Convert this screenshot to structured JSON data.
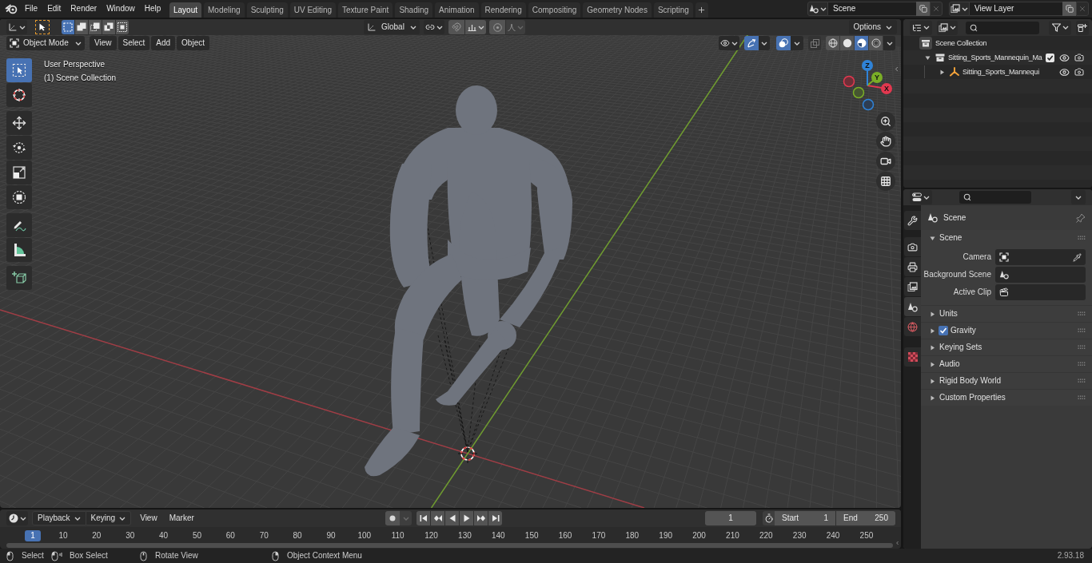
{
  "top_bar": {
    "menus": [
      "File",
      "Edit",
      "Render",
      "Window",
      "Help"
    ],
    "workspaces": [
      {
        "label": "Layout",
        "selected": true
      },
      {
        "label": "Modeling",
        "selected": false
      },
      {
        "label": "Sculpting",
        "selected": false
      },
      {
        "label": "UV Editing",
        "selected": false
      },
      {
        "label": "Texture Paint",
        "selected": false
      },
      {
        "label": "Shading",
        "selected": false
      },
      {
        "label": "Animation",
        "selected": false
      },
      {
        "label": "Rendering",
        "selected": false
      },
      {
        "label": "Compositing",
        "selected": false
      },
      {
        "label": "Geometry Nodes",
        "selected": false
      },
      {
        "label": "Scripting",
        "selected": false
      }
    ],
    "scene": "Scene",
    "view_layer": "View Layer"
  },
  "viewport": {
    "tool_settings": {
      "select_modes": [
        {
          "kind": "set",
          "selected": true
        },
        {
          "kind": "extend",
          "selected": false
        },
        {
          "kind": "subtract",
          "selected": false
        },
        {
          "kind": "difference",
          "selected": false
        },
        {
          "kind": "intersect",
          "selected": false
        }
      ],
      "orientation": "Global",
      "options": "Options"
    },
    "header": {
      "mode": "Object Mode",
      "menus": [
        "View",
        "Select",
        "Add",
        "Object"
      ],
      "gizmos_on": true,
      "overlays_on": true,
      "xray_on": false,
      "shading": [
        {
          "kind": "wireframe",
          "selected": false
        },
        {
          "kind": "solid",
          "selected": false
        },
        {
          "kind": "material",
          "selected": true
        },
        {
          "kind": "rendered",
          "selected": false
        }
      ]
    },
    "info": [
      "User Perspective",
      "(1) Scene Collection"
    ],
    "tool_groups": [
      [
        {
          "kind": "select_box",
          "selected": true
        },
        {
          "kind": "cursor",
          "selected": false
        }
      ],
      [
        {
          "kind": "move",
          "selected": false
        },
        {
          "kind": "rotate",
          "selected": false
        },
        {
          "kind": "scale",
          "selected": false
        },
        {
          "kind": "transform",
          "selected": false
        }
      ],
      [
        {
          "kind": "annotate",
          "selected": false
        },
        {
          "kind": "measure",
          "selected": false
        }
      ],
      [
        {
          "kind": "add_cube",
          "selected": false
        }
      ]
    ],
    "gizmo_axes": [
      "X",
      "Y",
      "Z"
    ]
  },
  "timeline": {
    "dropdowns": [
      "Playback",
      "Keying"
    ],
    "menus": [
      "View",
      "Marker"
    ],
    "auto_keying": false,
    "current_frame": "1",
    "start": {
      "label": "Start",
      "value": "1"
    },
    "end": {
      "label": "End",
      "value": "250"
    },
    "ruler": [
      {
        "label": "1",
        "selected": true
      },
      {
        "label": "10",
        "selected": false
      },
      {
        "label": "20",
        "selected": false
      },
      {
        "label": "30",
        "selected": false
      },
      {
        "label": "40",
        "selected": false
      },
      {
        "label": "50",
        "selected": false
      },
      {
        "label": "60",
        "selected": false
      },
      {
        "label": "70",
        "selected": false
      },
      {
        "label": "80",
        "selected": false
      },
      {
        "label": "90",
        "selected": false
      },
      {
        "label": "100",
        "selected": false
      },
      {
        "label": "110",
        "selected": false
      },
      {
        "label": "120",
        "selected": false
      },
      {
        "label": "130",
        "selected": false
      },
      {
        "label": "140",
        "selected": false
      },
      {
        "label": "150",
        "selected": false
      },
      {
        "label": "160",
        "selected": false
      },
      {
        "label": "170",
        "selected": false
      },
      {
        "label": "180",
        "selected": false
      },
      {
        "label": "190",
        "selected": false
      },
      {
        "label": "200",
        "selected": false
      },
      {
        "label": "210",
        "selected": false
      },
      {
        "label": "220",
        "selected": false
      },
      {
        "label": "230",
        "selected": false
      },
      {
        "label": "240",
        "selected": false
      },
      {
        "label": "250",
        "selected": false
      }
    ]
  },
  "outliner": {
    "tree": [
      {
        "label": "Scene Collection",
        "kind": "scene_collection",
        "children": [
          {
            "label": "Sitting_Sports_Mannequin_Ma",
            "kind": "collection",
            "expanded": true,
            "checked": true,
            "children": [
              {
                "label": "Sitting_Sports_Mannequi",
                "kind": "empty",
                "expanded": false
              }
            ]
          }
        ]
      }
    ]
  },
  "properties": {
    "tab_groups": [
      [
        {
          "kind": "tool",
          "selected": false
        }
      ],
      [
        {
          "kind": "render",
          "selected": false
        },
        {
          "kind": "output",
          "selected": false
        },
        {
          "kind": "view_layer",
          "selected": false
        },
        {
          "kind": "scene",
          "selected": true
        },
        {
          "kind": "world",
          "selected": false
        }
      ],
      [
        {
          "kind": "texture",
          "selected": false
        }
      ]
    ],
    "context": "Scene",
    "panel": {
      "title": "Scene",
      "expanded": true,
      "fields": [
        {
          "label": "Camera",
          "kind": "camera"
        },
        {
          "label": "Background Scene",
          "kind": "scene"
        },
        {
          "label": "Active Clip",
          "kind": "clip"
        }
      ]
    },
    "subpanels": [
      {
        "title": "Units",
        "kind": "plain",
        "expanded": false
      },
      {
        "title": "Gravity",
        "kind": "toggle",
        "checked": true,
        "expanded": false
      },
      {
        "title": "Keying Sets",
        "kind": "plain",
        "expanded": false
      },
      {
        "title": "Audio",
        "kind": "plain",
        "expanded": false
      },
      {
        "title": "Rigid Body World",
        "kind": "plain",
        "expanded": false
      },
      {
        "title": "Custom Properties",
        "kind": "plain",
        "expanded": false
      }
    ]
  },
  "status_bar": {
    "hints": [
      {
        "kind": "left_click",
        "label": "Select"
      },
      {
        "kind": "left_drag",
        "label": "Box Select"
      },
      {
        "kind": "middle_click",
        "label": "Rotate View"
      },
      {
        "kind": "right_click",
        "label": "Object Context Menu"
      }
    ],
    "version": "2.93.18"
  }
}
